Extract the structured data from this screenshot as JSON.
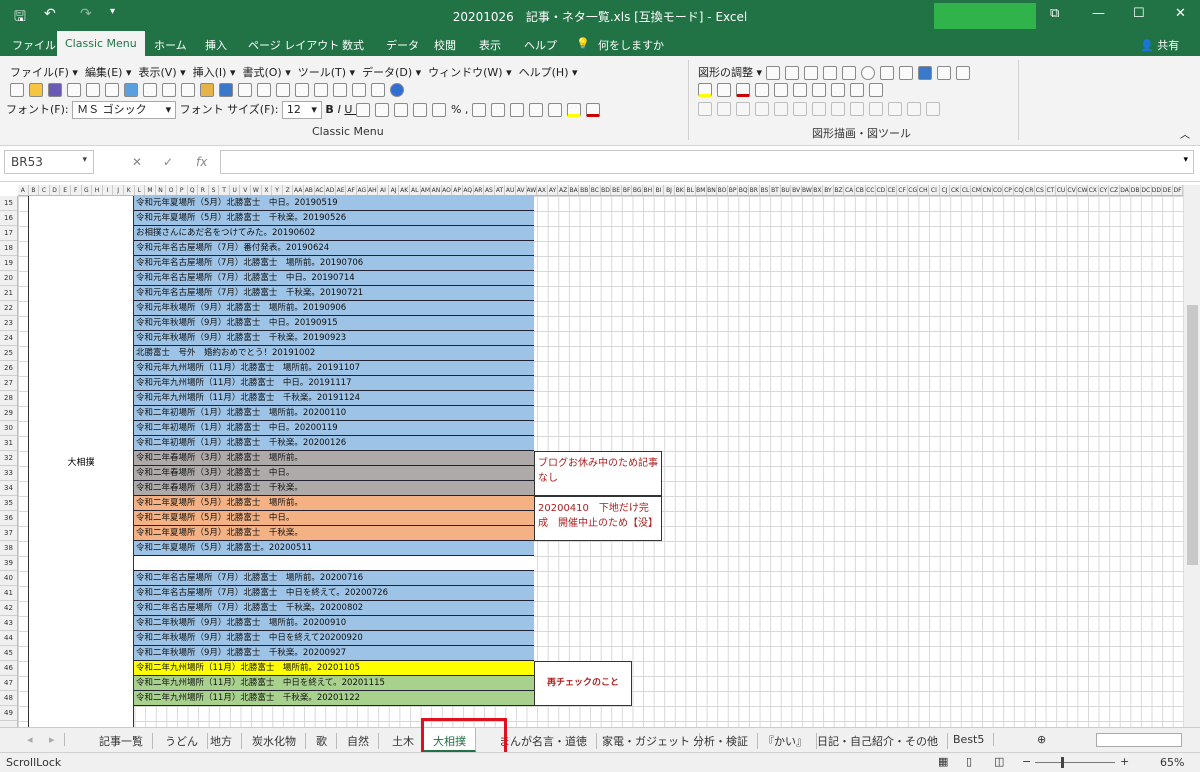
{
  "window": {
    "title": "20201026　記事・ネタ一覧.xls  [互換モード]  -  Excel",
    "share": "共有"
  },
  "ribbon_tabs": [
    "ファイル",
    "Classic Menu",
    "ホーム",
    "挿入",
    "ページ レイアウト",
    "数式",
    "データ",
    "校閲",
    "表示",
    "ヘルプ",
    "何をしますか"
  ],
  "classic_menu": {
    "menus": [
      "ファイル(F)",
      "編集(E)",
      "表示(V)",
      "挿入(I)",
      "書式(O)",
      "ツール(T)",
      "データ(D)",
      "ウィンドウ(W)",
      "ヘルプ(H)"
    ],
    "font_label": "フォント(F):",
    "font_value": "ＭＳ ゴシック",
    "size_label": "フォント サイズ(F):",
    "size_value": "12",
    "group_label": "Classic Menu"
  },
  "drawing": {
    "adjust": "図形の調整",
    "group_label": "図形描画・図ツール"
  },
  "formula_bar": {
    "name_box": "BR53",
    "fx": "fx",
    "value": ""
  },
  "columns": [
    "A",
    "B",
    "C",
    "D",
    "E",
    "F",
    "G",
    "H",
    "I",
    "J",
    "K",
    "L",
    "M",
    "N",
    "O",
    "P",
    "Q",
    "R",
    "S",
    "T",
    "U",
    "V",
    "W",
    "X",
    "Y",
    "Z",
    "AA",
    "AB",
    "AC",
    "AD",
    "AE",
    "AF",
    "AG",
    "AH",
    "AI",
    "AJ",
    "AK",
    "AL",
    "AM",
    "AN",
    "AO",
    "AP",
    "AQ",
    "AR",
    "AS",
    "AT",
    "AU",
    "AV",
    "AW",
    "AX",
    "AY",
    "AZ",
    "BA",
    "BB",
    "BC",
    "BD",
    "BE",
    "BF",
    "BG",
    "BH",
    "BI",
    "BJ",
    "BK",
    "BL",
    "BM",
    "BN",
    "BO",
    "BP",
    "BQ",
    "BR",
    "BS",
    "BT",
    "BU",
    "BV",
    "BW",
    "BX",
    "BY",
    "BZ",
    "CA",
    "CB",
    "CC",
    "CD",
    "CE",
    "CF",
    "CG",
    "CH",
    "CI",
    "CJ",
    "CK",
    "CL",
    "CM",
    "CN",
    "CO",
    "CP",
    "CQ",
    "CR",
    "CS",
    "CT",
    "CU",
    "CV",
    "CW",
    "CX",
    "CY",
    "CZ",
    "DA",
    "DB",
    "DC",
    "DD",
    "DE",
    "DF"
  ],
  "row_numbers": [
    15,
    16,
    17,
    18,
    19,
    20,
    21,
    22,
    23,
    24,
    25,
    26,
    27,
    28,
    29,
    30,
    31,
    32,
    33,
    34,
    35,
    36,
    37,
    38,
    39,
    40,
    41,
    42,
    43,
    44,
    45,
    46,
    47,
    48,
    49
  ],
  "category": "大相撲",
  "colors": {
    "blue": "#9dc3e6",
    "gray": "#aeaaaa",
    "orange": "#f4b183",
    "yellow": "#ffff00",
    "green": "#a9d18e",
    "white": "#ffffff",
    "accent": "#217346"
  },
  "rows": [
    {
      "text": "令和元年夏場所（5月）北勝富士　中日。20190519",
      "fill": "blue"
    },
    {
      "text": "令和元年夏場所（5月）北勝富士　千秋楽。20190526",
      "fill": "blue"
    },
    {
      "text": "お相撲さんにあだ名をつけてみた。20190602",
      "fill": "blue"
    },
    {
      "text": "令和元年名古屋場所（7月）番付発表。20190624",
      "fill": "blue"
    },
    {
      "text": "令和元年名古屋場所（7月）北勝富士　場所前。20190706",
      "fill": "blue"
    },
    {
      "text": "令和元年名古屋場所（7月）北勝富士　中日。20190714",
      "fill": "blue"
    },
    {
      "text": "令和元年名古屋場所（7月）北勝富士　千秋楽。20190721",
      "fill": "blue"
    },
    {
      "text": "令和元年秋場所（9月）北勝富士　場所前。20190906",
      "fill": "blue"
    },
    {
      "text": "令和元年秋場所（9月）北勝富士　中日。20190915",
      "fill": "blue"
    },
    {
      "text": "令和元年秋場所（9月）北勝富士　千秋楽。20190923",
      "fill": "blue"
    },
    {
      "text": "北勝富士　号外　婚約おめでとう！20191002",
      "fill": "blue"
    },
    {
      "text": "令和元年九州場所（11月）北勝富士　場所前。20191107",
      "fill": "blue"
    },
    {
      "text": "令和元年九州場所（11月）北勝富士　中日。20191117",
      "fill": "blue"
    },
    {
      "text": "令和元年九州場所（11月）北勝富士　千秋楽。20191124",
      "fill": "blue"
    },
    {
      "text": "令和二年初場所（1月）北勝富士　場所前。20200110",
      "fill": "blue"
    },
    {
      "text": "令和二年初場所（1月）北勝富士　中日。20200119",
      "fill": "blue"
    },
    {
      "text": "令和二年初場所（1月）北勝富士　千秋楽。20200126",
      "fill": "blue"
    },
    {
      "text": "令和二年春場所（3月）北勝富士　場所前。",
      "fill": "gray"
    },
    {
      "text": "令和二年春場所（3月）北勝富士　中日。",
      "fill": "gray"
    },
    {
      "text": "令和二年春場所（3月）北勝富士　千秋楽。",
      "fill": "gray"
    },
    {
      "text": "令和二年夏場所（5月）北勝富士　場所前。",
      "fill": "orange"
    },
    {
      "text": "令和二年夏場所（5月）北勝富士　中日。",
      "fill": "orange"
    },
    {
      "text": "令和二年夏場所（5月）北勝富士　千秋楽。",
      "fill": "orange"
    },
    {
      "text": "令和二年夏場所（5月）北勝富士。20200511",
      "fill": "blue"
    },
    {
      "text": "",
      "fill": "white"
    },
    {
      "text": "令和二年名古屋場所（7月）北勝富士　場所前。20200716",
      "fill": "blue"
    },
    {
      "text": "令和二年名古屋場所（7月）北勝富士　中日を終えて。20200726",
      "fill": "blue"
    },
    {
      "text": "令和二年名古屋場所（7月）北勝富士　千秋楽。20200802",
      "fill": "blue"
    },
    {
      "text": "令和二年秋場所（9月）北勝富士　場所前。20200910",
      "fill": "blue"
    },
    {
      "text": "令和二年秋場所（9月）北勝富士　中日を終えて20200920",
      "fill": "blue"
    },
    {
      "text": "令和二年秋場所（9月）北勝富士　千秋楽。20200927",
      "fill": "blue"
    },
    {
      "text": "令和二年九州場所（11月）北勝富士　場所前。20201105",
      "fill": "yellow"
    },
    {
      "text": "令和二年九州場所（11月）北勝富士　中日を終えて。20201115",
      "fill": "green"
    },
    {
      "text": "令和二年九州場所（11月）北勝富士　千秋楽。20201122",
      "fill": "green"
    }
  ],
  "notes": {
    "spring": "ブログお休み中のため記事なし",
    "summer": "20200410　下地だけ完成　開催中止のため【没】",
    "kyushu": "再チェックのこと"
  },
  "sheet_tabs": [
    "記事一覧",
    "うどん",
    "地方",
    "炭水化物",
    "歌",
    "自然",
    "土木",
    "大相撲",
    "まんが名言・道徳",
    "家電・ガジェット",
    "分析・検証",
    "『かい』",
    "日記・自己紹介・その他",
    "Best5"
  ],
  "active_sheet": "大相撲",
  "status": {
    "mode": "ScrollLock",
    "zoom": "65%",
    "zoom_level": 65
  }
}
